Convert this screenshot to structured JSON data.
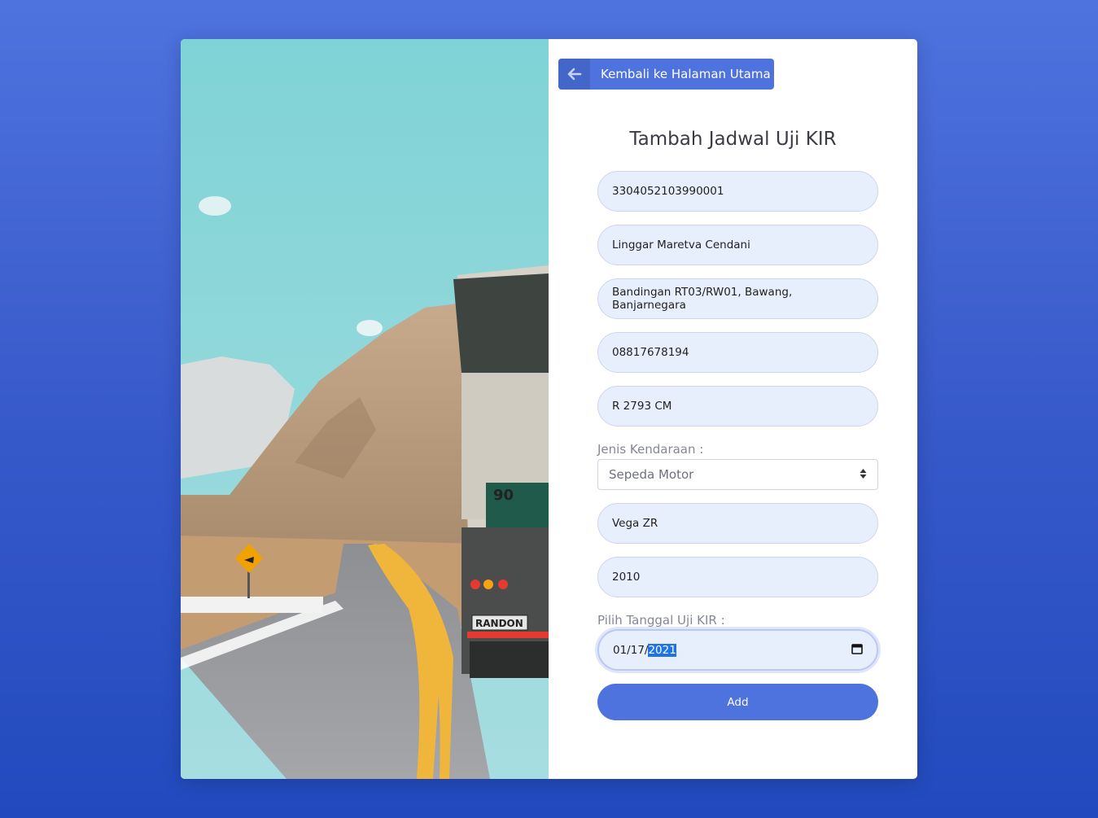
{
  "back_button": {
    "label": "Kembali ke Halaman Utama"
  },
  "title": "Tambah Jadwal Uji KIR",
  "fields": {
    "nik": "3304052103990001",
    "nama": "Linggar Maretva Cendani",
    "alamat": "Bandingan RT03/RW01, Bawang, Banjarnegara",
    "telepon": "08817678194",
    "plat": "R 2793 CM",
    "jenis_label": "Jenis Kendaraan :",
    "jenis_value": "Sepeda Motor",
    "merk": "Vega ZR",
    "tahun": "2010",
    "tanggal_label": "Pilih Tanggal Uji KIR :",
    "tanggal_prefix": "01/17/",
    "tanggal_selected": "2021"
  },
  "submit_label": "Add",
  "truck_texts": {
    "number": "90",
    "brand": "RANDON"
  },
  "colors": {
    "primary": "#4e73df",
    "input_bg": "#e8effc"
  }
}
